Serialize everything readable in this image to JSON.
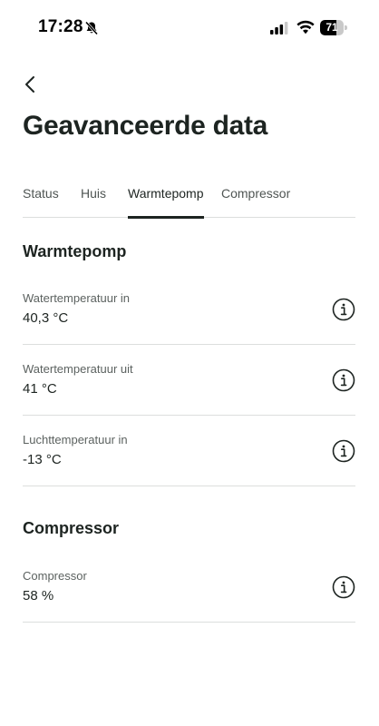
{
  "status_bar": {
    "time": "17:28",
    "battery_level": "71",
    "icons": [
      "bell-slash-icon",
      "cellular-signal-icon",
      "wifi-icon",
      "battery-icon"
    ]
  },
  "nav": {
    "back_icon": "chevron-left-icon"
  },
  "page": {
    "title": "Geavanceerde data"
  },
  "tabs": [
    {
      "label": "Status",
      "active": false
    },
    {
      "label": "Huis",
      "active": false
    },
    {
      "label": "Warmtepomp",
      "active": true
    },
    {
      "label": "Compressor",
      "active": false
    }
  ],
  "sections": [
    {
      "heading": "Warmtepomp",
      "rows": [
        {
          "label": "Watertemperatuur in",
          "value": "40,3 °C",
          "icon": "info-icon"
        },
        {
          "label": "Watertemperatuur uit",
          "value": "41 °C",
          "icon": "info-icon"
        },
        {
          "label": "Luchttemperatuur in",
          "value": "-13 °C",
          "icon": "info-icon"
        }
      ]
    },
    {
      "heading": "Compressor",
      "rows": [
        {
          "label": "Compressor",
          "value": "58 %",
          "icon": "info-icon"
        }
      ]
    }
  ],
  "colors": {
    "text_primary": "#1d2421",
    "text_secondary": "#5c6260",
    "divider": "#dcdedd",
    "background": "#ffffff"
  }
}
